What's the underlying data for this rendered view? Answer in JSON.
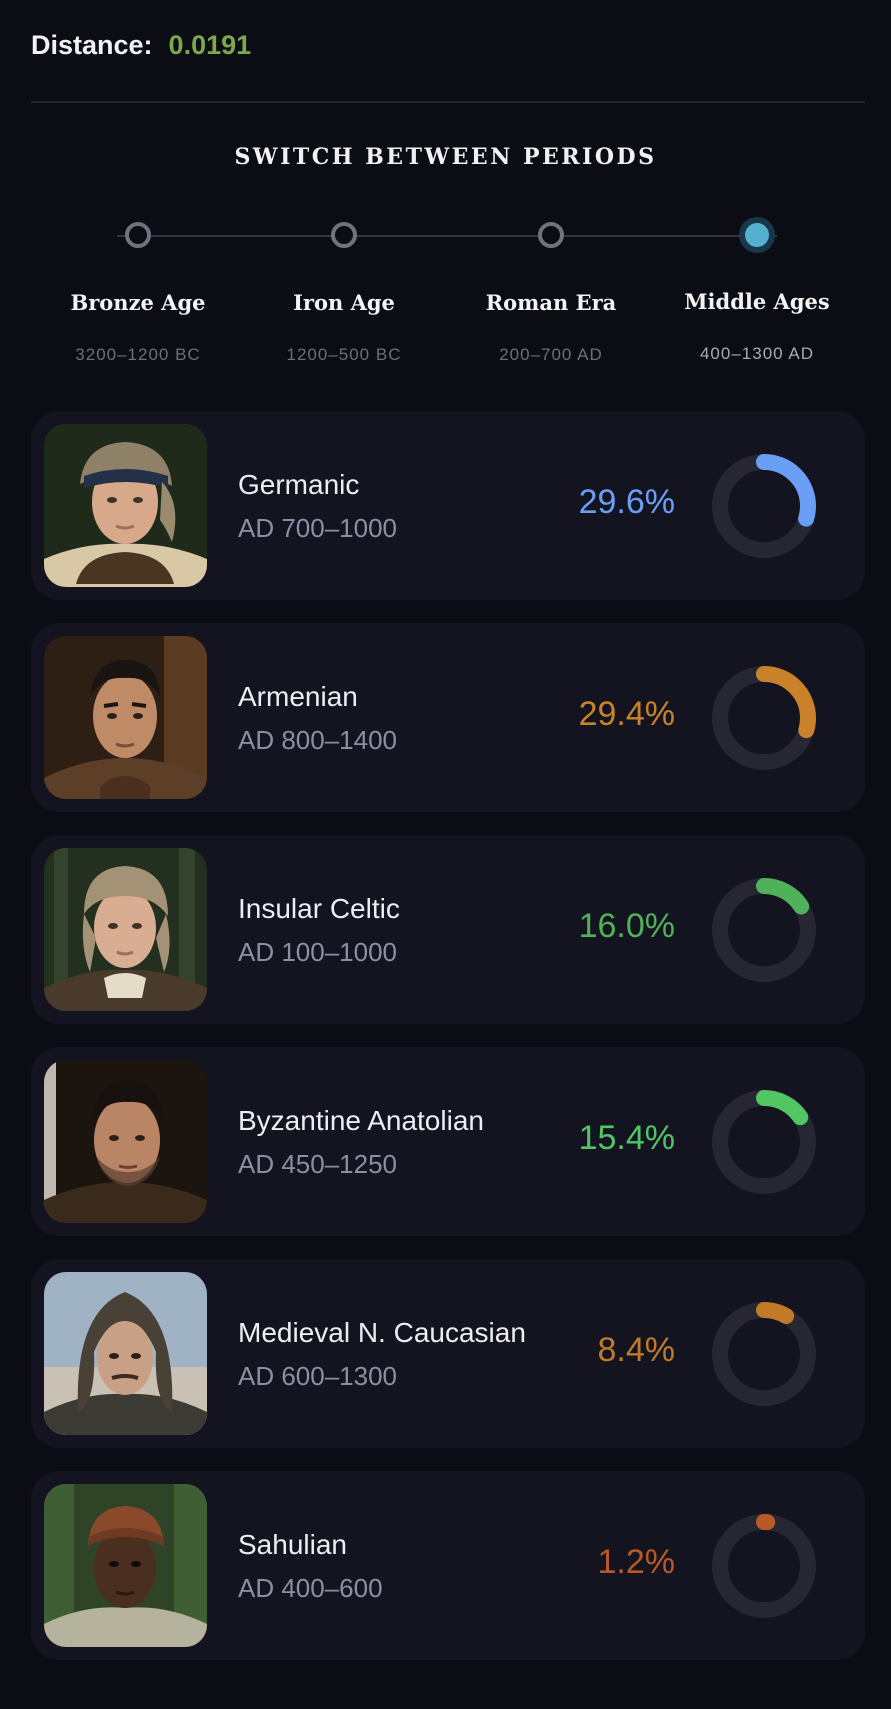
{
  "distance": {
    "label": "Distance:",
    "value": "0.0191",
    "color": "#7aa84b"
  },
  "periods_title": "SWITCH BETWEEN PERIODS",
  "periods": [
    {
      "name": "Bronze Age",
      "range": "3200–1200 BC",
      "active": false
    },
    {
      "name": "Iron Age",
      "range": "1200–500 BC",
      "active": false
    },
    {
      "name": "Roman Era",
      "range": "200–700 AD",
      "active": false
    },
    {
      "name": "Middle Ages",
      "range": "400–1300 AD",
      "active": true
    }
  ],
  "populations": [
    {
      "name": "Germanic",
      "range": "AD 700–1000",
      "percent": "29.6%",
      "fraction": 0.296,
      "color": "#6b9ff5",
      "portrait": "woman-headscarf-portrait-icon"
    },
    {
      "name": "Armenian",
      "range": "AD 800–1400",
      "percent": "29.4%",
      "fraction": 0.294,
      "color": "#c9822a",
      "portrait": "man-dark-hair-portrait-icon"
    },
    {
      "name": "Insular Celtic",
      "range": "AD 100–1000",
      "percent": "16.0%",
      "fraction": 0.16,
      "color": "#4fb25a",
      "portrait": "woman-bonnet-portrait-icon"
    },
    {
      "name": "Byzantine Anatolian",
      "range": "AD 450–1250",
      "percent": "15.4%",
      "fraction": 0.154,
      "color": "#52c564",
      "portrait": "man-beard-portrait-icon"
    },
    {
      "name": "Medieval N. Caucasian",
      "range": "AD 600–1300",
      "percent": "8.4%",
      "fraction": 0.084,
      "color": "#c07a28",
      "portrait": "man-hood-portrait-icon"
    },
    {
      "name": "Sahulian",
      "range": "AD 400–600",
      "percent": "1.2%",
      "fraction": 0.012,
      "color": "#b85a25",
      "portrait": "man-turban-portrait-icon"
    }
  ]
}
